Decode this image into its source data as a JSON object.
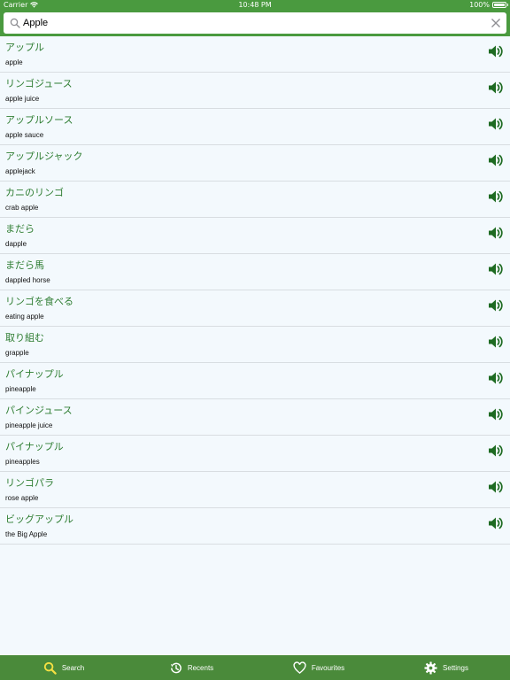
{
  "status_bar": {
    "carrier": "Carrier",
    "time": "10:48 PM",
    "battery": "100%",
    "battery_level": 1.0
  },
  "search": {
    "value": "Apple",
    "placeholder": "Search"
  },
  "results": [
    {
      "jp": "アップル",
      "en": "apple"
    },
    {
      "jp": "リンゴジュース",
      "en": "apple juice"
    },
    {
      "jp": "アップルソース",
      "en": "apple sauce"
    },
    {
      "jp": "アップルジャック",
      "en": "applejack"
    },
    {
      "jp": "カニのリンゴ",
      "en": "crab apple"
    },
    {
      "jp": "まだら",
      "en": "dapple"
    },
    {
      "jp": "まだら馬",
      "en": "dappled horse"
    },
    {
      "jp": "リンゴを食べる",
      "en": "eating apple"
    },
    {
      "jp": "取り組む",
      "en": "grapple"
    },
    {
      "jp": "パイナップル",
      "en": "pineapple"
    },
    {
      "jp": "パインジュース",
      "en": "pineapple juice"
    },
    {
      "jp": "パイナップル",
      "en": "pineapples"
    },
    {
      "jp": "リンゴパラ",
      "en": "rose apple"
    },
    {
      "jp": "ビッグアップル",
      "en": "the Big Apple"
    }
  ],
  "icons": {
    "row_action": "speaker-icon",
    "search": "search-icon",
    "clear": "close-icon"
  },
  "tabs": [
    {
      "label": "Search",
      "icon": "search-icon",
      "active": true
    },
    {
      "label": "Recents",
      "icon": "history-icon",
      "active": false
    },
    {
      "label": "Favourites",
      "icon": "heart-icon",
      "active": false
    },
    {
      "label": "Settings",
      "icon": "gear-icon",
      "active": false
    }
  ],
  "colors": {
    "header_green": "#4a9a3f",
    "tabbar_green": "#4a8a3a",
    "japanese_text": "#2e7d32",
    "speaker": "#1e6b22",
    "active_tab_icon": "#f5e142",
    "list_background": "#f3f9fd"
  }
}
